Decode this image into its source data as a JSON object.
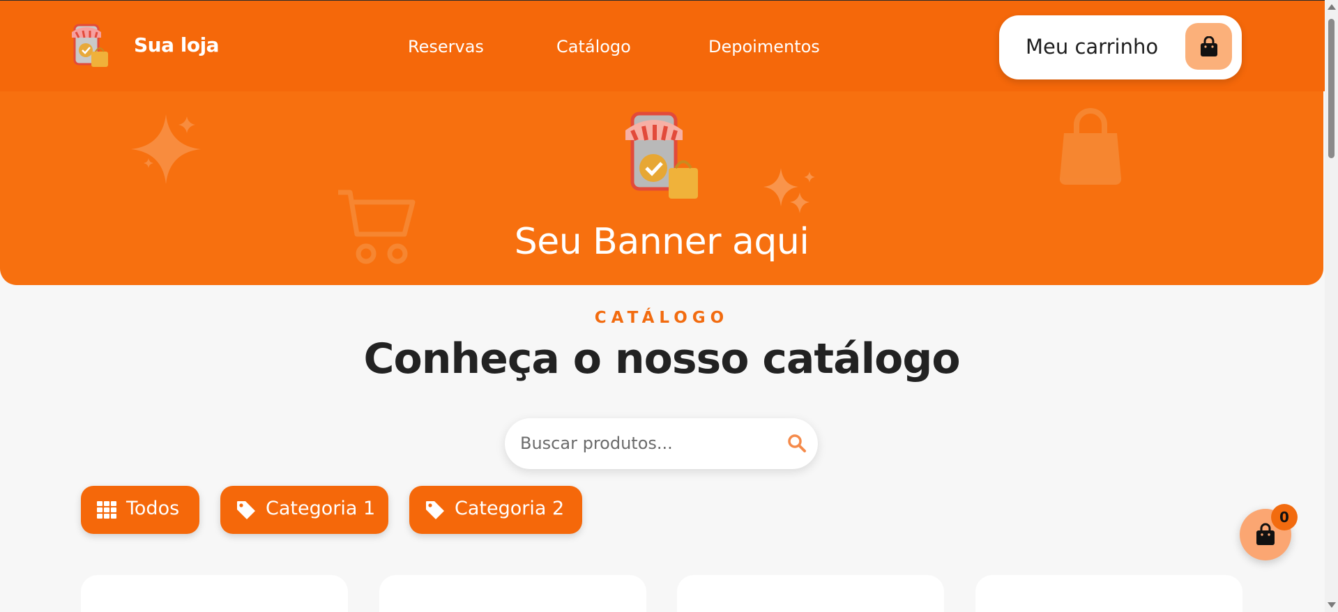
{
  "header": {
    "brand": "Sua loja",
    "nav": [
      "Reservas",
      "Catálogo",
      "Depoimentos"
    ],
    "cart_label": "Meu carrinho"
  },
  "banner": {
    "title": "Seu Banner aqui"
  },
  "catalog": {
    "eyebrow": "CATÁLOGO",
    "title": "Conheça o nosso catálogo"
  },
  "search": {
    "placeholder": "Buscar produtos..."
  },
  "categories": [
    {
      "label": "Todos",
      "icon": "grid-icon"
    },
    {
      "label": "Categoria 1",
      "icon": "tag-icon"
    },
    {
      "label": "Categoria 2",
      "icon": "tag-icon"
    }
  ],
  "floating_cart": {
    "count": "0"
  },
  "colors": {
    "primary": "#f5680a",
    "banner": "#f7700f",
    "accent_light": "#fbb07a",
    "text_dark": "#222222"
  }
}
